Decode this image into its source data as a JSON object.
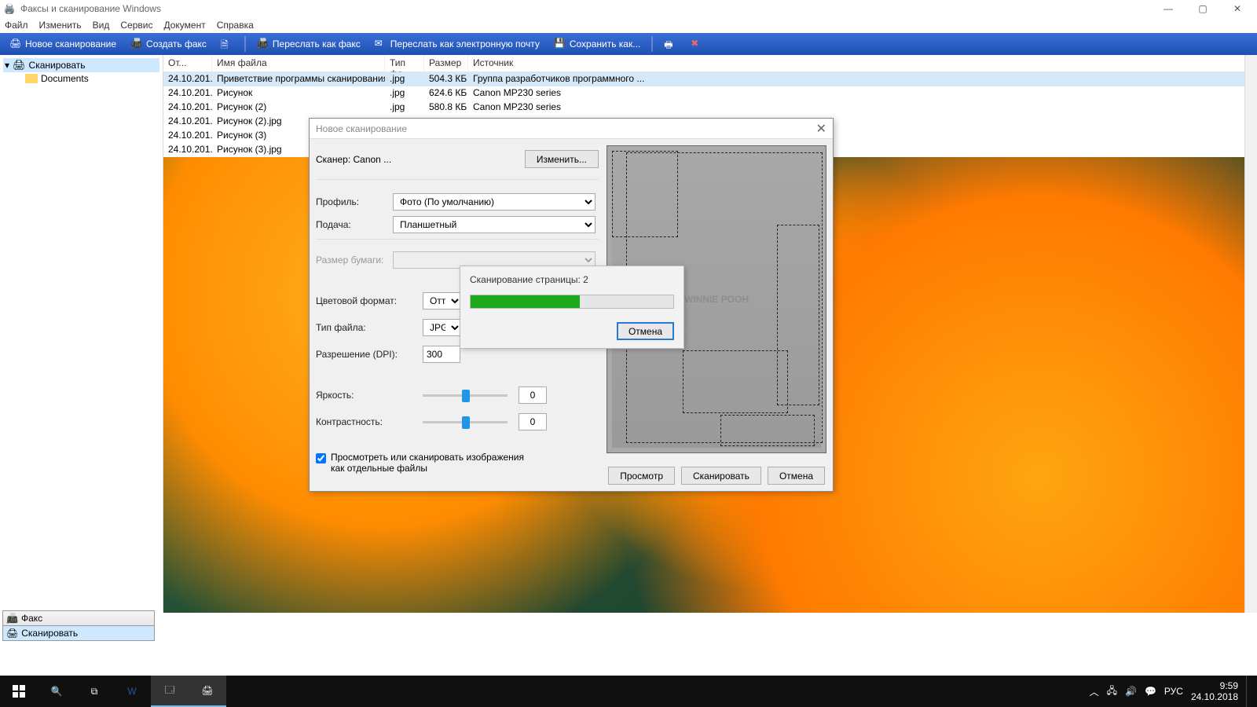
{
  "window": {
    "title": "Факсы и сканирование Windows",
    "controls": {
      "min": "—",
      "max": "▢",
      "close": "✕"
    }
  },
  "menubar": [
    "Файл",
    "Изменить",
    "Вид",
    "Сервис",
    "Документ",
    "Справка"
  ],
  "toolbar": [
    {
      "label": "Новое сканирование"
    },
    {
      "label": "Создать факс"
    },
    {
      "label": ""
    },
    {
      "label": "Переслать как факс"
    },
    {
      "label": "Переслать как электронную почту"
    },
    {
      "label": "Сохранить как..."
    }
  ],
  "tree": {
    "root": "Сканировать",
    "child": "Documents"
  },
  "columns": {
    "date": "От...",
    "name": "Имя файла",
    "type": "Тип фа...",
    "size": "Размер",
    "source": "Источник"
  },
  "rows": [
    {
      "date": "24.10.201...",
      "name": "Приветствие программы сканирования",
      "type": ".jpg",
      "size": "504.3 КБ",
      "source": "Группа разработчиков программного ...",
      "sel": true
    },
    {
      "date": "24.10.201...",
      "name": "Рисунок",
      "type": ".jpg",
      "size": "624.6 КБ",
      "source": "Canon MP230 series"
    },
    {
      "date": "24.10.201...",
      "name": "Рисунок (2)",
      "type": ".jpg",
      "size": "580.8 КБ",
      "source": "Canon MP230 series"
    },
    {
      "date": "24.10.201...",
      "name": "Рисунок (2).jpg",
      "type": "",
      "size": "",
      "source": ""
    },
    {
      "date": "24.10.201...",
      "name": "Рисунок (3)",
      "type": "",
      "size": "",
      "source": ""
    },
    {
      "date": "24.10.201...",
      "name": "Рисунок (3).jpg",
      "type": "",
      "size": "",
      "source": ""
    }
  ],
  "bottom_tabs": {
    "fax": "Факс",
    "scan": "Сканировать"
  },
  "dialog": {
    "title": "Новое сканирование",
    "scanner_label": "Сканер: Canon ...",
    "change_btn": "Изменить...",
    "profile_label": "Профиль:",
    "profile_value": "Фото (По умолчанию)",
    "source_label": "Подача:",
    "source_value": "Планшетный",
    "paper_label": "Размер бумаги:",
    "color_label": "Цветовой формат:",
    "color_value": "Оттенки",
    "filetype_label": "Тип файла:",
    "filetype_value": "JPG (Рис",
    "dpi_label": "Разрешение (DPI):",
    "dpi_value": "300",
    "brightness_label": "Яркость:",
    "brightness_value": "0",
    "contrast_label": "Контрастность:",
    "contrast_value": "0",
    "separate_label": "Просмотреть или сканировать изображения как отдельные файлы",
    "preview_btn": "Просмотр",
    "scan_btn": "Сканировать",
    "cancel_btn": "Отмена",
    "preview_text": "WINNIE POOH"
  },
  "progress": {
    "text": "Сканирование страницы: 2",
    "cancel": "Отмена",
    "percent": 54
  },
  "taskbar": {
    "lang": "РУС",
    "time": "9:59",
    "date": "24.10.2018"
  }
}
